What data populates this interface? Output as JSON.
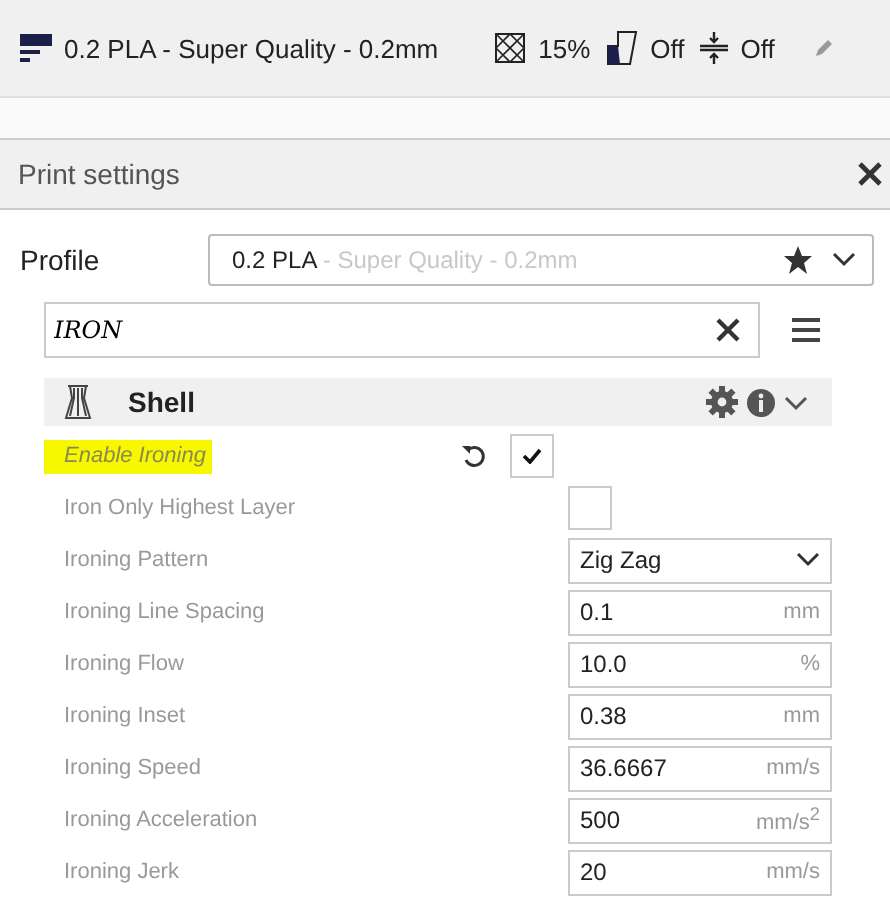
{
  "top_bar": {
    "profile": "0.2 PLA - Super Quality - 0.2mm",
    "infill": "15%",
    "support": "Off",
    "adhesion": "Off"
  },
  "panel": {
    "title": "Print settings",
    "profile_label": "Profile",
    "profile_value": {
      "name": "0.2 PLA",
      "detail": " - Super Quality - 0.2mm"
    },
    "search": {
      "value": "IRON"
    },
    "category": {
      "title": "Shell",
      "expanded": true
    },
    "settings": [
      {
        "kind": "checkbox",
        "label": "Enable Ironing",
        "checked": true,
        "highlighted": true,
        "modified": true
      },
      {
        "kind": "checkbox",
        "label": "Iron Only Highest Layer",
        "checked": false,
        "highlighted": false,
        "modified": false
      },
      {
        "kind": "dropdown",
        "label": "Ironing Pattern",
        "value": "Zig Zag",
        "highlighted": false,
        "modified": false
      },
      {
        "kind": "number",
        "label": "Ironing Line Spacing",
        "value": "0.1",
        "unit": "mm",
        "highlighted": false,
        "modified": false
      },
      {
        "kind": "number",
        "label": "Ironing Flow",
        "value": "10.0",
        "unit": "%",
        "highlighted": false,
        "modified": false
      },
      {
        "kind": "number",
        "label": "Ironing Inset",
        "value": "0.38",
        "unit": "mm",
        "highlighted": false,
        "modified": false
      },
      {
        "kind": "number",
        "label": "Ironing Speed",
        "value": "36.6667",
        "unit": "mm/s",
        "highlighted": false,
        "modified": false
      },
      {
        "kind": "number",
        "label": "Ironing Acceleration",
        "value": "500",
        "unit": "mm/s$^{2}$",
        "highlighted": false,
        "modified": false
      },
      {
        "kind": "number",
        "label": "Ironing Jerk",
        "value": "20",
        "unit": "mm/s",
        "highlighted": false,
        "modified": false
      }
    ]
  }
}
